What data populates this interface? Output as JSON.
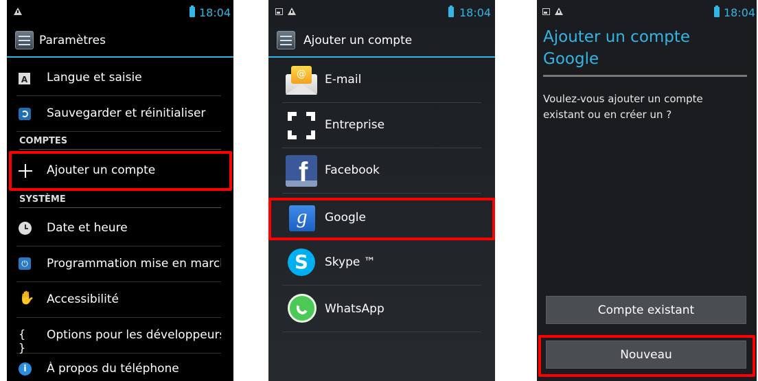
{
  "colors": {
    "accent": "#33b5e5",
    "highlight": "#ff0000"
  },
  "screen1": {
    "time": "18:04",
    "title": "Paramètres",
    "items_top": [
      {
        "label": "Langue et saisie",
        "icon": "keyboard-a-icon"
      },
      {
        "label": "Sauvegarder et réinitialiser",
        "icon": "backup-restore-icon"
      }
    ],
    "section_accounts": "COMPTES",
    "add_account": "Ajouter un compte",
    "section_system": "SYSTÈME",
    "items_system": [
      {
        "label": "Date et heure",
        "icon": "clock-icon"
      },
      {
        "label": "Programmation mise en marche",
        "icon": "power-schedule-icon"
      },
      {
        "label": "Accessibilité",
        "icon": "hand-icon"
      },
      {
        "label": "Options pour les développeurs",
        "icon": "braces-icon"
      },
      {
        "label": "À propos du téléphone",
        "icon": "info-icon"
      }
    ]
  },
  "screen2": {
    "time": "18:04",
    "title": "Ajouter un compte",
    "accounts": [
      {
        "label": "E-mail",
        "icon": "email-icon"
      },
      {
        "label": "Entreprise",
        "icon": "corporate-icon"
      },
      {
        "label": "Facebook",
        "icon": "facebook-icon"
      },
      {
        "label": "Google",
        "icon": "google-icon"
      },
      {
        "label": "Skype ™",
        "icon": "skype-icon"
      },
      {
        "label": "WhatsApp",
        "icon": "whatsapp-icon"
      }
    ]
  },
  "screen3": {
    "time": "18:04",
    "title": "Ajouter un compte Google",
    "question": "Voulez-vous ajouter un compte existant ou en créer un ?",
    "existing_button": "Compte existant",
    "new_button": "Nouveau"
  }
}
